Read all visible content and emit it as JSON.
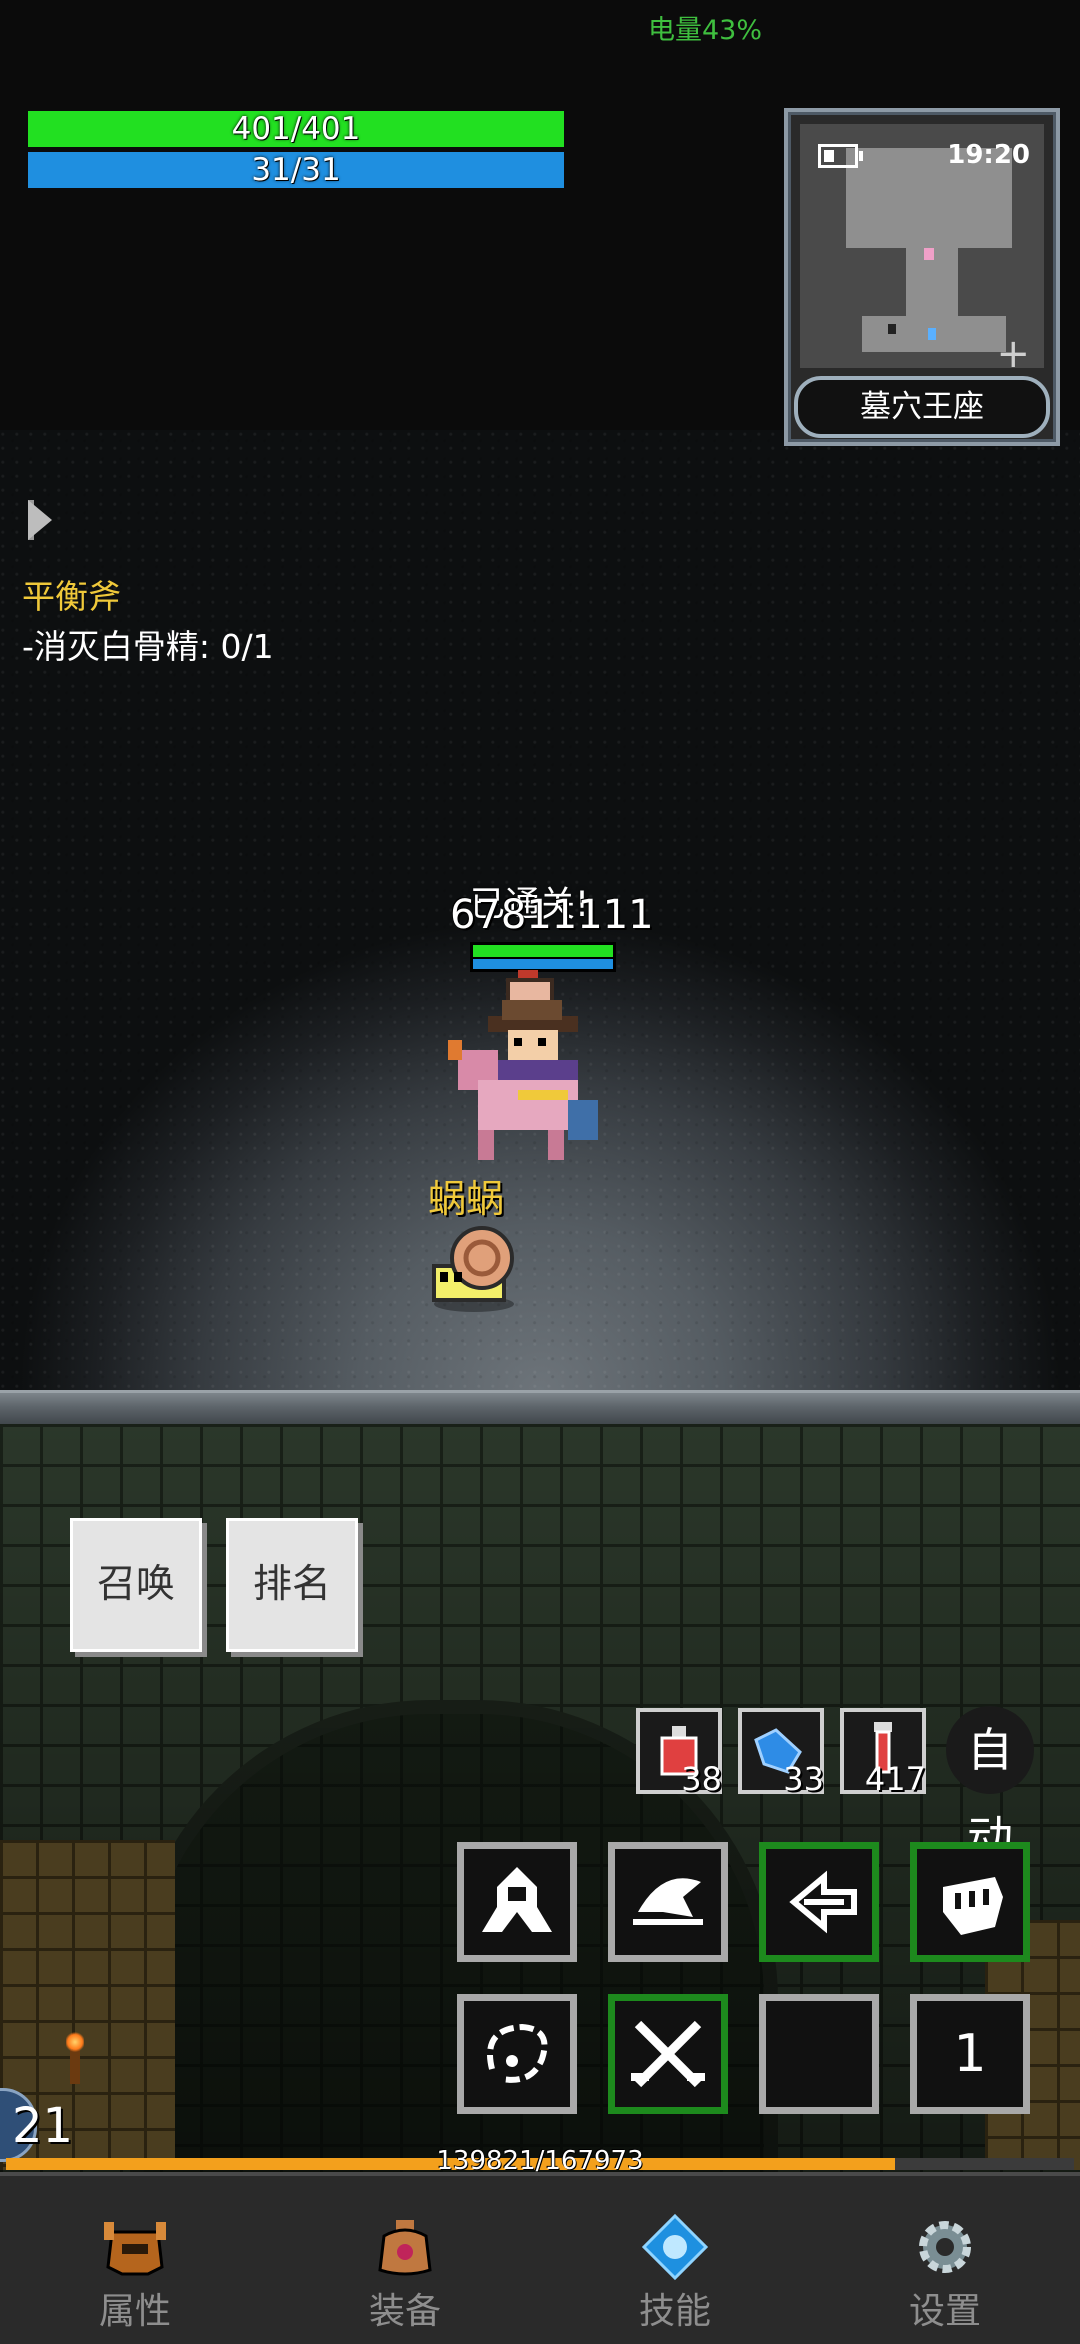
{
  "status": {
    "battery_text": "电量43%",
    "hp": "401/401",
    "mp": "31/31"
  },
  "minimap": {
    "time": "19:20",
    "location": "墓穴王座"
  },
  "quest": {
    "title": "平衡斧",
    "objective": "-消灭白骨精: 0/1"
  },
  "hero": {
    "cleared_text": "已通关!",
    "name": "67811111"
  },
  "enemy": {
    "name": "蜗蜗"
  },
  "menu": {
    "summon": "召唤",
    "ranking": "排名"
  },
  "potions": [
    {
      "icon": "red-potion-icon",
      "count": "38"
    },
    {
      "icon": "blue-flask-icon",
      "count": "33"
    },
    {
      "icon": "red-vial-icon",
      "count": "417"
    }
  ],
  "auto_label": "自动",
  "skills": {
    "slot8_count": "1"
  },
  "player": {
    "level": "21",
    "exp_text": "139821/167973",
    "exp_fraction": 0.8324
  },
  "nav": {
    "attributes": "属性",
    "equipment": "装备",
    "skills": "技能",
    "settings": "设置"
  },
  "colors": {
    "hp": "#22e021",
    "mp": "#1f8fe0",
    "quest_title": "#f0c93a",
    "exp": "#f3a01c"
  }
}
